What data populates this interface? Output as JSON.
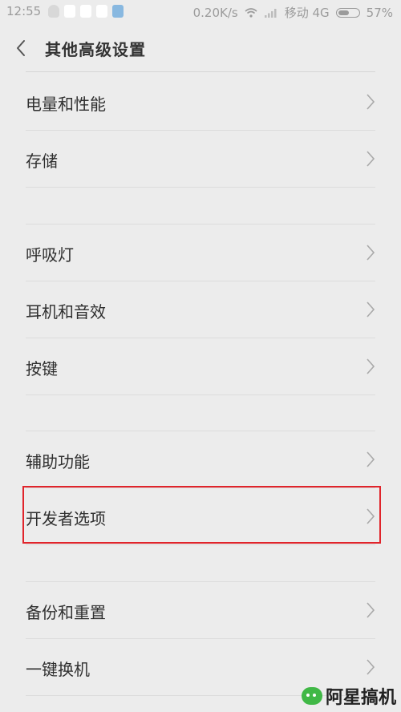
{
  "status_bar": {
    "time": "12:55",
    "speed": "0.20K/s",
    "carrier": "移动 4G",
    "battery": "57%",
    "battery_level": 0.57
  },
  "header": {
    "title": "其他高级设置"
  },
  "rows": [
    {
      "label": "电量和性能"
    },
    {
      "label": "存储"
    },
    {
      "label": "呼吸灯"
    },
    {
      "label": "耳机和音效"
    },
    {
      "label": "按键"
    },
    {
      "label": "辅助功能"
    },
    {
      "label": "开发者选项"
    },
    {
      "label": "备份和重置"
    },
    {
      "label": "一键换机"
    }
  ],
  "watermark": "阿星搞机",
  "colors": {
    "highlight": "#e0242b",
    "background": "#ececec"
  }
}
